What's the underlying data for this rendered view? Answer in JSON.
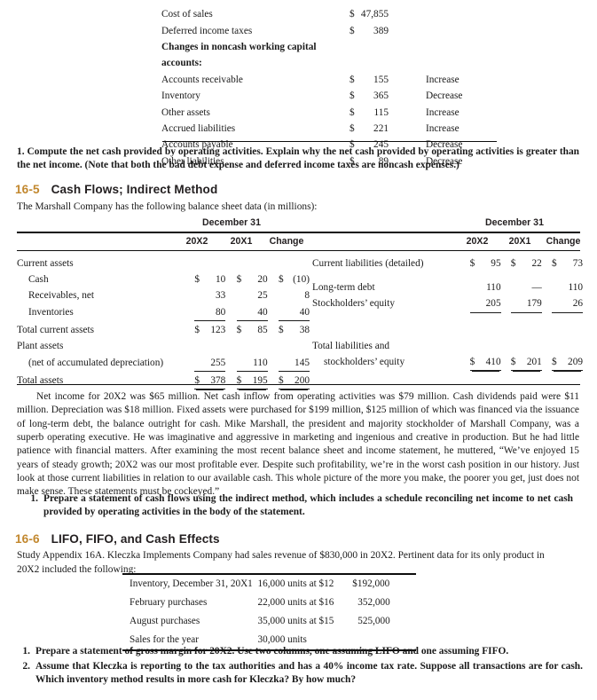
{
  "top_schedule": {
    "rows": [
      {
        "label": "Cost of sales",
        "bold": false,
        "currency": "$",
        "amount": "47,855",
        "note": ""
      },
      {
        "label": "Deferred income taxes",
        "bold": false,
        "currency": "$",
        "amount": "389",
        "note": ""
      },
      {
        "label": "Changes in noncash working capital",
        "bold": true,
        "currency": "",
        "amount": "",
        "note": ""
      },
      {
        "label": "accounts:",
        "bold": true,
        "currency": "",
        "amount": "",
        "note": ""
      },
      {
        "label": "Accounts receivable",
        "bold": false,
        "currency": "$",
        "amount": "155",
        "note": "Increase"
      },
      {
        "label": "Inventory",
        "bold": false,
        "currency": "$",
        "amount": "365",
        "note": "Decrease"
      },
      {
        "label": "Other assets",
        "bold": false,
        "currency": "$",
        "amount": "115",
        "note": "Increase"
      },
      {
        "label": "Accrued liabilities",
        "bold": false,
        "currency": "$",
        "amount": "221",
        "note": "Increase"
      },
      {
        "label": "Accounts payable",
        "bold": false,
        "currency": "$",
        "amount": "245",
        "note": "Decrease"
      },
      {
        "label": "Other liabilities",
        "bold": false,
        "currency": "$",
        "amount": "89",
        "note": "Decrease"
      }
    ]
  },
  "requirement_top": "1. Compute the net cash provided by operating activities. Explain why the net cash provided by operating activities is greater than the net income. (Note that both the bad debt expense and deferred income taxes are noncash expenses.)",
  "section_16_5": {
    "number": "16-5",
    "title": "Cash Flows; Indirect Method",
    "lead": "The Marshall Company has the following balance sheet data (in millions):",
    "caption_left": "December 31",
    "caption_right": "December 31",
    "columns": [
      "20X2",
      "20X1",
      "Change"
    ],
    "left_rows": [
      {
        "label": "Current assets",
        "indent": 0,
        "cells": [
          "",
          "",
          ""
        ],
        "currencies": [
          "",
          "",
          ""
        ],
        "underline": "none"
      },
      {
        "label": "Cash",
        "indent": 1,
        "cells": [
          "10",
          "20",
          "(10)"
        ],
        "currencies": [
          "$",
          "$",
          "$"
        ],
        "underline": "none"
      },
      {
        "label": "Receivables, net",
        "indent": 1,
        "cells": [
          "33",
          "25",
          "8"
        ],
        "currencies": [
          "",
          "",
          ""
        ],
        "underline": "none"
      },
      {
        "label": "Inventories",
        "indent": 1,
        "cells": [
          "80",
          "40",
          "40"
        ],
        "currencies": [
          "",
          "",
          ""
        ],
        "underline": "single"
      },
      {
        "label": "Total current assets",
        "indent": 0,
        "cells": [
          "123",
          "85",
          "38"
        ],
        "currencies": [
          "$",
          "$",
          "$"
        ],
        "underline": "none"
      },
      {
        "label": "Plant assets",
        "indent": 0,
        "cells": [
          "",
          "",
          ""
        ],
        "currencies": [
          "",
          "",
          ""
        ],
        "underline": "none"
      },
      {
        "label": "(net of accumulated depreciation)",
        "indent": 1,
        "cells": [
          "255",
          "110",
          "145"
        ],
        "currencies": [
          "",
          "",
          ""
        ],
        "underline": "single"
      },
      {
        "label": "Total assets",
        "indent": 0,
        "cells": [
          "378",
          "195",
          "200"
        ],
        "currencies": [
          "$",
          "$",
          "$"
        ],
        "underline": "double"
      }
    ],
    "right_rows": [
      {
        "label": "Current liabilities (detailed)",
        "indent": 0,
        "cells": [
          "95",
          "22",
          "73"
        ],
        "currencies": [
          "$",
          "$",
          "$"
        ],
        "underline": "none"
      },
      {
        "label": "Long-term debt",
        "indent": 0,
        "cells": [
          "110",
          "—",
          "110"
        ],
        "currencies": [
          "",
          "",
          ""
        ],
        "underline": "none"
      },
      {
        "label": "Stockholders’ equity",
        "indent": 0,
        "cells": [
          "205",
          "179",
          "26"
        ],
        "currencies": [
          "",
          "",
          ""
        ],
        "underline": "single"
      },
      {
        "label": "Total liabilities and",
        "indent": 0,
        "cells": [
          "",
          "",
          ""
        ],
        "currencies": [
          "",
          "",
          ""
        ],
        "underline": "none"
      },
      {
        "label": "stockholders’ equity",
        "indent": 1,
        "cells": [
          "410",
          "201",
          "209"
        ],
        "currencies": [
          "$",
          "$",
          "$"
        ],
        "underline": "double"
      }
    ],
    "narrative": "Net income for 20X2 was $65 million. Net cash inflow from operating activities was $79 million. Cash dividends paid were $11 million. Depreciation was $18 million. Fixed assets were purchased for $199 million, $125 million of which was financed via the issuance of long-term debt, the balance outright for cash. Mike Marshall, the president and majority stockholder of Marshall Company, was a superb operating executive. He was imaginative and aggressive in marketing and ingenious and creative in production. But he had little patience with financial matters. After examining the most recent balance sheet and income statement, he muttered, “We’ve enjoyed 15 years of steady growth; 20X2 was our most profitable ever. Despite such profitability, we’re in the worst cash position in our history. Just look at those current liabilities in relation to our available cash. This whole picture of the more you make, the poorer you get, just does not make sense. These statements must be cockeyed.”",
    "requirements": [
      {
        "marker": "1.",
        "text": "Prepare a statement of cash flows using the indirect method, which includes a schedule reconciling net income to net cash provided by operating activities in the body of the statement."
      }
    ]
  },
  "section_16_6": {
    "number": "16-6",
    "title": "LIFO, FIFO, and Cash Effects",
    "lead": "Study Appendix 16A. Kleczka Implements Company had sales revenue of $830,000 in 20X2. Pertinent data for its only product in 20X2 included the following:",
    "inventory_rows": [
      {
        "label": "Inventory, December 31, 20X1",
        "units": "16,000 units at $12",
        "amount": "$192,000"
      },
      {
        "label": "February purchases",
        "units": "22,000 units at $16",
        "amount": "352,000"
      },
      {
        "label": "August purchases",
        "units": "35,000 units at $15",
        "amount": "525,000"
      },
      {
        "label": "Sales for the year",
        "units": "30,000 units",
        "amount": ""
      }
    ],
    "requirements": [
      {
        "marker": "1.",
        "text": "Prepare a statement of gross margin for 20X2. Use two columns, one assuming LIFO and one assuming FIFO."
      },
      {
        "marker": "2.",
        "text": "Assume that Kleczka is reporting to the tax authorities and has a 40% income tax rate. Suppose all transactions are for cash. Which inventory method results in more cash for Kleczka? By how much?"
      }
    ]
  },
  "colors": {
    "section_number": "#c2882f",
    "heading_text": "#231f20",
    "body_text": "#1a1a1a",
    "rule": "#0d0d0d"
  }
}
